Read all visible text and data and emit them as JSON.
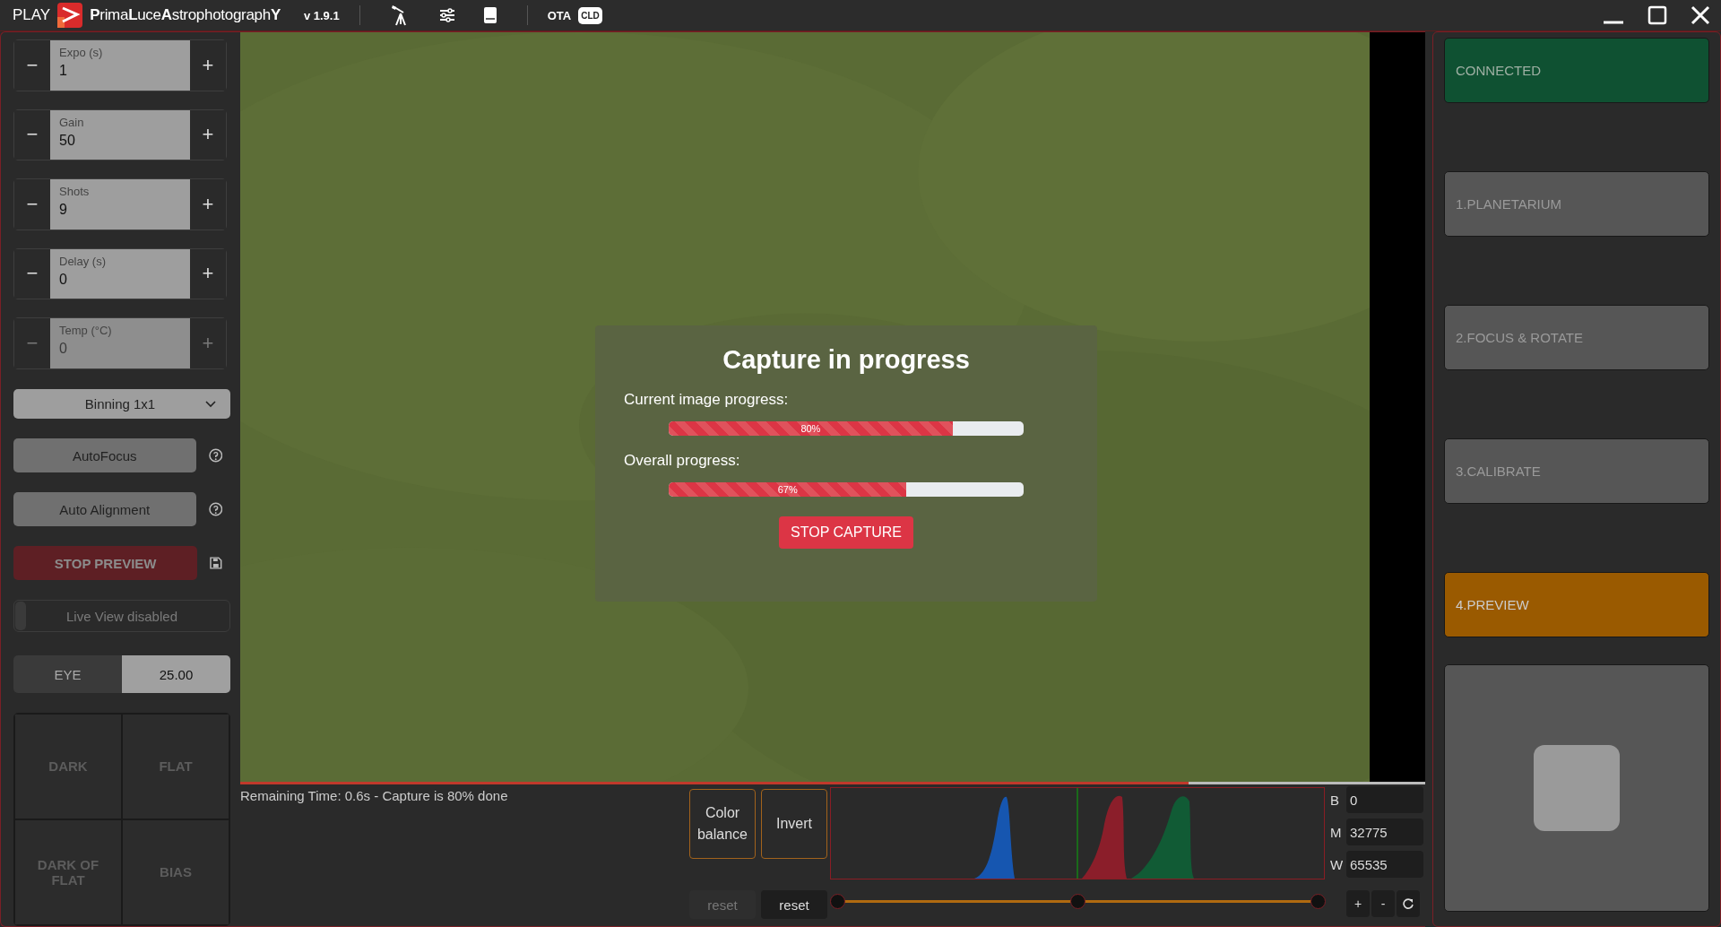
{
  "title_bar": {
    "play": "PLAY",
    "app_name": "**P**rima**L**uce**A**strophotograph**Y**",
    "version": "v 1.9.1",
    "ota": "OTA",
    "cld": "CLD"
  },
  "controls": {
    "steppers": [
      {
        "label": "Expo (s)",
        "value": "1",
        "minus": "−",
        "plus": "+",
        "disabled": false
      },
      {
        "label": "Gain",
        "value": "50",
        "minus": "−",
        "plus": "+",
        "disabled": false
      },
      {
        "label": "Shots",
        "value": "9",
        "minus": "−",
        "plus": "+",
        "disabled": false
      },
      {
        "label": "Delay (s)",
        "value": "0",
        "minus": "−",
        "plus": "+",
        "disabled": false
      },
      {
        "label": "Temp (°C)",
        "value": "0",
        "minus": "−",
        "plus": "+",
        "disabled": true
      }
    ],
    "binning": "Binning 1x1",
    "autofocus": "AutoFocus",
    "auto_alignment": "Auto Alignment",
    "stop_preview": "STOP PREVIEW",
    "live_view": {
      "label": "Live View disabled",
      "on": false
    },
    "eye": {
      "label": "EYE",
      "value": "25.00"
    },
    "calibration": [
      "DARK",
      "FLAT",
      "DARK OF FLAT",
      "BIAS"
    ]
  },
  "capture_dialog": {
    "title": "Capture in progress",
    "progress": [
      {
        "label": "Current image progress:",
        "level": 0.8,
        "reading": "80%"
      },
      {
        "label": "Overall progress:",
        "level": 0.67,
        "reading": "67%"
      }
    ],
    "button": "STOP CAPTURE"
  },
  "image_progress": {
    "level": 0.8
  },
  "status_text": "Remaining Time: 0.6s  -  Capture is 80% done",
  "color_balance": "Color\nbalance",
  "invert": "Invert",
  "reset_buttons": [
    {
      "label": "reset",
      "disabled": true
    },
    {
      "label": "reset",
      "disabled": false
    }
  ],
  "stretch_handles": [
    {
      "level": 0
    },
    {
      "level": 0.5
    },
    {
      "level": 1
    }
  ],
  "levels": [
    {
      "label": "B",
      "value": "0"
    },
    {
      "label": "M",
      "value": "32775"
    },
    {
      "label": "W",
      "value": "65535"
    }
  ],
  "zoom_buttons": [
    "+",
    "-"
  ],
  "workflow": {
    "connection": "CONNECTED",
    "steps": [
      {
        "label": "1.PLANETARIUM",
        "selected": false
      },
      {
        "label": "2.FOCUS & ROTATE",
        "selected": false
      },
      {
        "label": "3.CALIBRATE",
        "selected": false
      },
      {
        "label": "4.PREVIEW",
        "selected": true
      }
    ]
  }
}
